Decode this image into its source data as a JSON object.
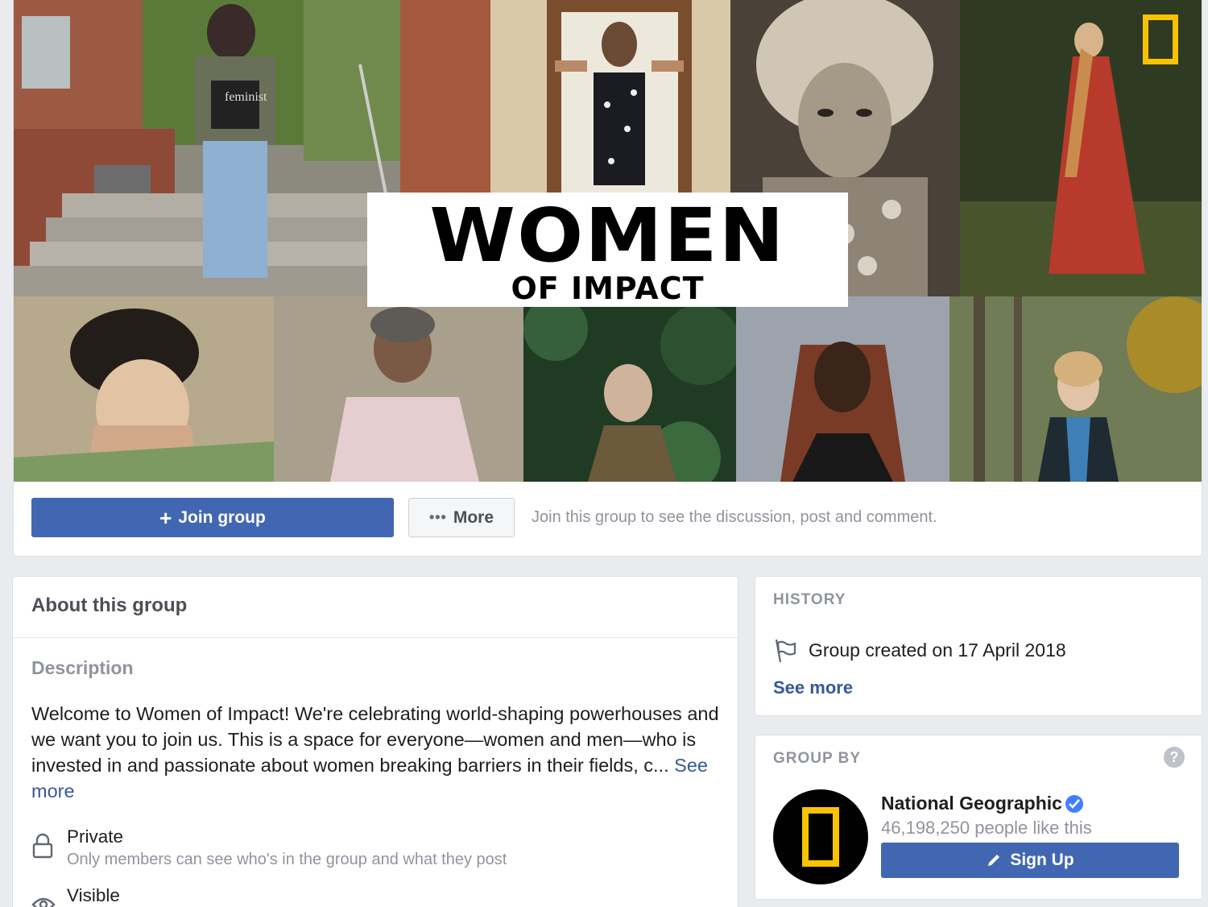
{
  "cover": {
    "title_main": "WOMEN",
    "title_sub": "OF IMPACT",
    "shirt_text": "feminist"
  },
  "actions": {
    "join_label": "Join group",
    "more_label": "More",
    "join_hint": "Join this group to see the discussion, post and comment."
  },
  "about": {
    "title": "About this group",
    "description_heading": "Description",
    "description_text": "Welcome to Women of Impact! We're celebrating world-shaping powerhouses and we want you to join us. This is a space for everyone—women and men—who is invested in and passionate about women breaking barriers in their fields, c... ",
    "see_more": "See more",
    "privacy_label": "Private",
    "privacy_sub": "Only members can see who's in the group and what they post",
    "visible_label": "Visible"
  },
  "history": {
    "label": "HISTORY",
    "created_text": "Group created on 17 April 2018",
    "see_more": "See more"
  },
  "group_by": {
    "label": "GROUP BY",
    "help": "?",
    "page_name": "National Geographic",
    "likes": "46,198,250 people like this",
    "signup_label": "Sign Up"
  },
  "colors": {
    "brand_blue": "#4267b2",
    "link_blue": "#365899",
    "natgeo_yellow": "#f8c300",
    "page_bg": "#e9ebee"
  }
}
